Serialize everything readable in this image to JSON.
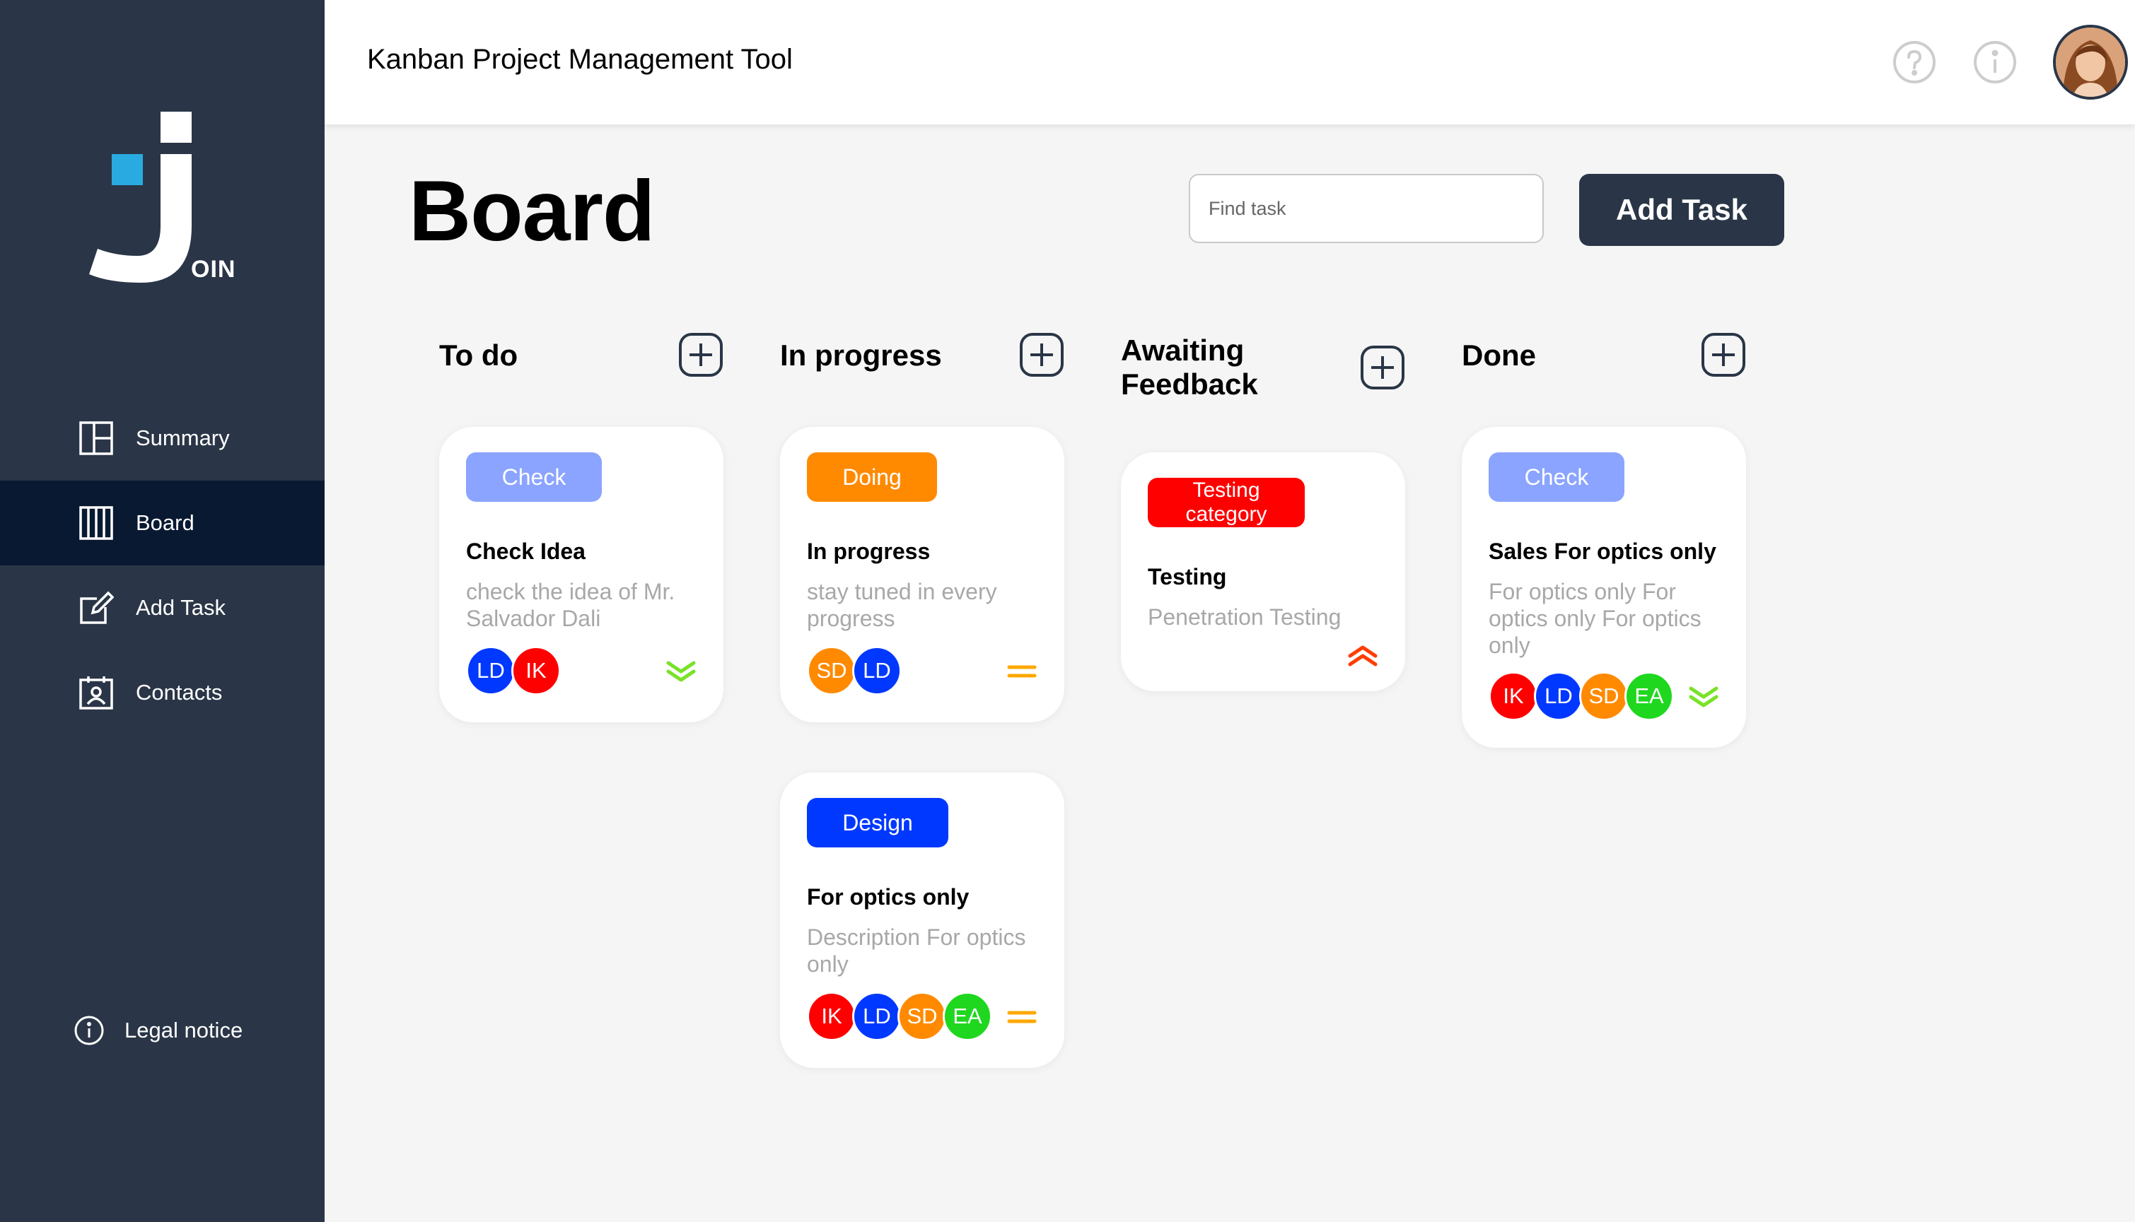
{
  "header": {
    "title": "Kanban Project Management Tool"
  },
  "logo": {
    "text": "OIN"
  },
  "sidebar": {
    "items": [
      {
        "label": "Summary",
        "icon": "summary-icon"
      },
      {
        "label": "Board",
        "icon": "board-icon",
        "active": true
      },
      {
        "label": "Add Task",
        "icon": "edit-icon"
      },
      {
        "label": "Contacts",
        "icon": "contacts-icon"
      }
    ],
    "legal": "Legal notice"
  },
  "page": {
    "title": "Board"
  },
  "search": {
    "placeholder": "Find task"
  },
  "add_task_button": "Add Task",
  "columns": [
    {
      "title": "To do"
    },
    {
      "title": "In progress"
    },
    {
      "title": "Awaiting Feedback"
    },
    {
      "title": "Done"
    }
  ],
  "cards": [
    {
      "column": "To do",
      "tag": "Check",
      "tag_color": "#8aa4ff",
      "title": "Check Idea",
      "description": "check the idea of Mr. Salvador Dali",
      "assignees": [
        "LD",
        "IK"
      ],
      "priority": "low"
    },
    {
      "column": "In progress",
      "tag": "Doing",
      "tag_color": "#ff8a00",
      "title": "In progress",
      "description": "stay tuned in every progress",
      "assignees": [
        "SD",
        "LD"
      ],
      "priority": "medium"
    },
    {
      "column": "In progress",
      "tag": "Design",
      "tag_color": "#0038ff",
      "title": "For optics only",
      "description": "Description For optics only",
      "assignees": [
        "IK",
        "LD",
        "SD",
        "EA"
      ],
      "priority": "medium"
    },
    {
      "column": "Awaiting Feedback",
      "tag": "Testing category",
      "tag_color": "#ff0000",
      "title": "Testing",
      "description": "Penetration Testing",
      "assignees": [],
      "priority": "urgent"
    },
    {
      "column": "Done",
      "tag": "Check",
      "tag_color": "#8aa4ff",
      "title": "Sales For optics only",
      "description": "For optics only For optics only For optics only",
      "assignees": [
        "IK",
        "LD",
        "SD",
        "EA"
      ],
      "priority": "low"
    }
  ],
  "colors": {
    "sidebar": "#2a3647",
    "sidebar_active": "#091931",
    "avatar_LD": "#0038ff",
    "avatar_IK": "#ff0000",
    "avatar_SD": "#ff8a00",
    "avatar_EA": "#1fd71f",
    "priority_low": "#7ae229",
    "priority_medium": "#ffa800",
    "priority_urgent": "#ff3d00"
  }
}
